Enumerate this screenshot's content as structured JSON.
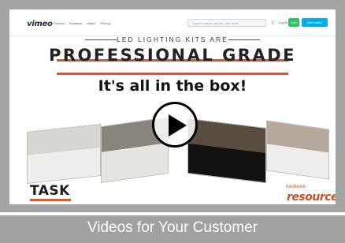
{
  "player": {
    "logo": "vimeo",
    "nav": [
      "Product",
      "Solutions",
      "Watch",
      "Pricing"
    ],
    "search_placeholder": "Search videos, people, and more",
    "login_label": "Log in",
    "join_label": "Join",
    "new_video_label": "New video"
  },
  "promo": {
    "tagline": "LED LIGHTING KITS ARE",
    "headline": "PROFESSIONAL GRADE",
    "subhead": "It's all in the box!",
    "left_brand": "TASK",
    "right_brand_small": "hardware",
    "right_brand": "resource"
  },
  "caption": "Videos for Your Customer",
  "colors": {
    "frame": "#a2a4a6",
    "accent_rule": "#c65a43",
    "join": "#31c463",
    "new_video": "#00adef",
    "task_accent": "#e0591d"
  },
  "icons": [
    "search-icon",
    "play-icon"
  ]
}
